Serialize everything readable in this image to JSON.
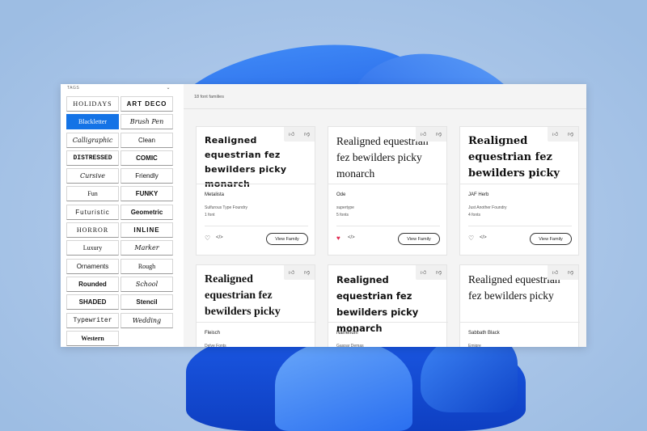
{
  "sidebar": {
    "heading": "TAGS",
    "tags": [
      {
        "label": "HOLIDAYS",
        "style": "serif wide"
      },
      {
        "label": "ART DECO",
        "style": "bold wide"
      },
      {
        "label": "Blackletter",
        "style": "serif",
        "active": true
      },
      {
        "label": "Brush Pen",
        "style": "italic"
      },
      {
        "label": "Calligraphic",
        "style": "italic"
      },
      {
        "label": "Clean",
        "style": ""
      },
      {
        "label": "DISTRESSED",
        "style": "mono bold"
      },
      {
        "label": "COMIC",
        "style": "bold"
      },
      {
        "label": "Cursive",
        "style": "italic"
      },
      {
        "label": "Friendly",
        "style": ""
      },
      {
        "label": "Fun",
        "style": "serif"
      },
      {
        "label": "FUNKY",
        "style": "bold"
      },
      {
        "label": "Futuristic",
        "style": "wide"
      },
      {
        "label": "Geometric",
        "style": "bold"
      },
      {
        "label": "HORROR",
        "style": "serif wide"
      },
      {
        "label": "INLINE",
        "style": "bold wide"
      },
      {
        "label": "Luxury",
        "style": "serif"
      },
      {
        "label": "Marker",
        "style": "italic"
      },
      {
        "label": "Ornaments",
        "style": ""
      },
      {
        "label": "Rough",
        "style": "serif"
      },
      {
        "label": "Rounded",
        "style": "bold"
      },
      {
        "label": "School",
        "style": "italic"
      },
      {
        "label": "SHADED",
        "style": "bold"
      },
      {
        "label": "Stencil",
        "style": "bold"
      },
      {
        "label": "Typewriter",
        "style": "mono"
      },
      {
        "label": "Wedding",
        "style": "italic"
      },
      {
        "label": "Western",
        "style": "serif bold"
      }
    ]
  },
  "main": {
    "family_count": "18 font families",
    "view_label": "View Family",
    "cards": [
      {
        "sample": "Realigned equestrian fez bewilders picky monarch",
        "name": "Metalista",
        "foundry": "Sulfurous Type Foundry",
        "fonts": "1 font",
        "liked": false,
        "variant": "stencil"
      },
      {
        "sample": "Realigned equestrian fez bewilders picky monarch",
        "name": "Ode",
        "foundry": "supertype",
        "fonts": "5 fonts",
        "liked": true,
        "variant": "thin"
      },
      {
        "sample": "Realigned equestrian fez bewilders picky",
        "name": "JAF Herb",
        "foundry": "Just Another Foundry",
        "fonts": "4 fonts",
        "liked": false,
        "variant": "black"
      },
      {
        "sample": "Realigned equestrian fez bewilders picky",
        "name": "Fleisch",
        "foundry": "Delve Fonts",
        "fonts": "",
        "liked": false,
        "variant": "slab"
      },
      {
        "sample": "Realigned equestrian fez bewilders picky monarch",
        "name": "Narrenum",
        "foundry": "Gaspar Demas",
        "fonts": "",
        "liked": false,
        "variant": "sansb"
      },
      {
        "sample": "Realigned equestrian fez bewilders picky",
        "name": "Sabbath Black",
        "foundry": "Emigre",
        "fonts": "",
        "liked": false,
        "variant": "thin"
      }
    ]
  },
  "icons": {
    "thumb_up": "thumb-up-icon",
    "thumb_down": "thumb-down-icon",
    "heart": "heart-icon",
    "code": "code-icon",
    "chevron": "chevron-down-icon"
  },
  "colors": {
    "accent": "#1473e6",
    "liked": "#e0284f"
  }
}
